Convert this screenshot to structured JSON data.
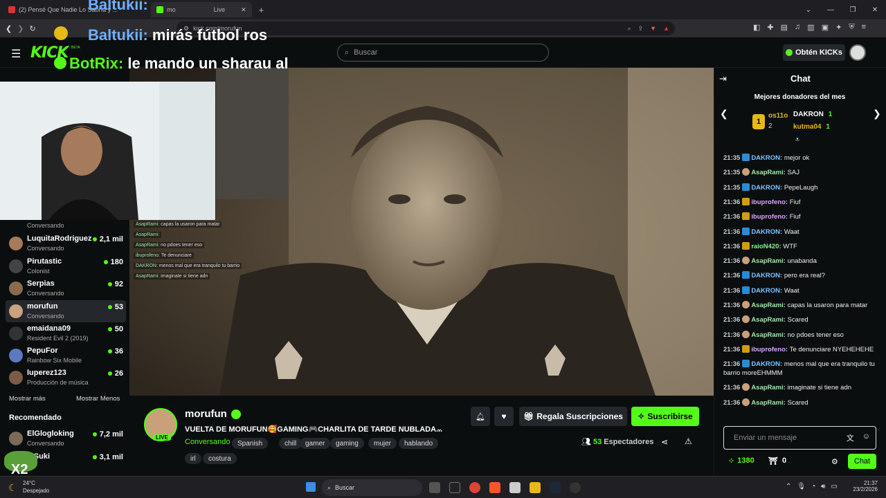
{
  "browser": {
    "tab_title": "(2) Pensé Que Nadie Lo Sabría y ...",
    "tab_title_2": "mo",
    "tab_title_3": "Live",
    "url": "kick.com/morufun"
  },
  "overlay_chat": [
    {
      "user": "Baltukii:",
      "text": "mirás fútbol ros"
    },
    {
      "user": "BotRix:",
      "text": "le mando un sharau al"
    }
  ],
  "header": {
    "logo": "KICK",
    "beta": "BETA",
    "search_placeholder": "Buscar",
    "get_kicks": "Obtén KICKs"
  },
  "sidebar": {
    "first_category": "Conversando",
    "channels": [
      {
        "name": "LuquitaRodriguez",
        "category": "Conversando",
        "viewers": "2,1 mil"
      },
      {
        "name": "Pirutastic",
        "category": "Colonist",
        "viewers": "180"
      },
      {
        "name": "Serpias",
        "category": "Conversando",
        "viewers": "92"
      },
      {
        "name": "morufun",
        "category": "Conversando",
        "viewers": "53"
      },
      {
        "name": "emaidana09",
        "category": "Resident Evil 2 (2019)",
        "viewers": "50"
      },
      {
        "name": "PepuFor",
        "category": "Rainbow Six Mobile",
        "viewers": "36"
      },
      {
        "name": "luperez123",
        "category": "Producción de música",
        "viewers": "26"
      }
    ],
    "show_more": "Mostrar más",
    "show_less": "Mostrar Menos",
    "recommended_title": "Recomendado",
    "recommended": [
      {
        "name": "ElGlogloking",
        "category": "Conversando",
        "viewers": "7,2 mil"
      },
      {
        "name": "etSuki",
        "category": "",
        "viewers": "3,1 mil"
      }
    ]
  },
  "video_overlay_chat": [
    {
      "user": "AsapRami",
      "text": ": capas la usaron para matar"
    },
    {
      "user": "AsapRami",
      "text": ":"
    },
    {
      "user": "AsapRami",
      "text": ": no pdoes tener eso"
    },
    {
      "user": "ibuprofeno",
      "text": ": Te denunciare"
    },
    {
      "user": "DAKRON",
      "text": ": menos mal que era tranquilo tu barrio"
    },
    {
      "user": "AsapRami",
      "text": ": imaginate si tiene adn"
    }
  ],
  "stream": {
    "channel": "morufun",
    "live_badge": "LIVE",
    "title": "VUELTA DE MORUFUN🥰GAMING🎮CHARLITA DE TARDE NUBLADA...",
    "category": "Conversando",
    "tags": [
      "Spanish",
      "chill",
      "gamer",
      "gaming",
      "mujer",
      "hablando",
      "irl",
      "costura"
    ],
    "gift_label": "Regala Suscripciones",
    "subscribe_label": "Suscribirse",
    "viewers": "53",
    "viewers_label": "Espectadores"
  },
  "chat": {
    "title": "Chat",
    "top_donors_title": "Mejores donadores del mes",
    "donors": [
      {
        "rank": "1",
        "name": "os11o",
        "amount": ""
      },
      {
        "rank": "2",
        "name": "",
        "amount": ""
      },
      {
        "name": "DAKRON",
        "amount": "1"
      },
      {
        "name": "kutma04",
        "amount": "1"
      }
    ],
    "messages": [
      {
        "time": "21:35",
        "user": "DAKRON",
        "color": "#7ec4ff",
        "badge": "blue",
        "text": "mejor ok"
      },
      {
        "time": "21:35",
        "user": "AsapRami",
        "color": "#9fe6a8",
        "badge": "avatar",
        "text": "SAJ"
      },
      {
        "time": "21:35",
        "user": "DAKRON",
        "color": "#7ec4ff",
        "badge": "blue",
        "text": "PepeLaugh"
      },
      {
        "time": "21:36",
        "user": "ibuprofeno",
        "color": "#d9a6ff",
        "badge": "gold",
        "text": "Fiuf"
      },
      {
        "time": "21:36",
        "user": "ibuprofeno",
        "color": "#d9a6ff",
        "badge": "gold",
        "text": "Fiuf"
      },
      {
        "time": "21:36",
        "user": "DAKRON",
        "color": "#7ec4ff",
        "badge": "blue",
        "text": "Waat"
      },
      {
        "time": "21:36",
        "user": "raioN420",
        "color": "#8ef08e",
        "badge": "gold",
        "text": "WTF"
      },
      {
        "time": "21:36",
        "user": "AsapRami",
        "color": "#9fe6a8",
        "badge": "avatar",
        "text": "unabanda"
      },
      {
        "time": "21:36",
        "user": "DAKRON",
        "color": "#7ec4ff",
        "badge": "blue",
        "text": "pero era real?"
      },
      {
        "time": "21:36",
        "user": "DAKRON",
        "color": "#7ec4ff",
        "badge": "blue",
        "text": "Waat"
      },
      {
        "time": "21:36",
        "user": "AsapRami",
        "color": "#9fe6a8",
        "badge": "avatar",
        "text": "capas la usaron para matar"
      },
      {
        "time": "21:36",
        "user": "AsapRami",
        "color": "#9fe6a8",
        "badge": "avatar",
        "text": "Scared"
      },
      {
        "time": "21:36",
        "user": "AsapRami",
        "color": "#9fe6a8",
        "badge": "avatar",
        "text": "no pdoes tener eso"
      },
      {
        "time": "21:36",
        "user": "ibuprofeno",
        "color": "#d9a6ff",
        "badge": "gold",
        "text": "Te denunciare NYEHEHEHE"
      },
      {
        "time": "21:36",
        "user": "DAKRON",
        "color": "#7ec4ff",
        "badge": "blue",
        "text": "menos mal que era tranquilo tu barrio moreEHMMM"
      },
      {
        "time": "21:36",
        "user": "AsapRami",
        "color": "#9fe6a8",
        "badge": "avatar",
        "text": "imaginate si tiene adn"
      },
      {
        "time": "21:36",
        "user": "AsapRami",
        "color": "#9fe6a8",
        "badge": "avatar",
        "text": "Scared"
      }
    ],
    "input_placeholder": "Enviar un mensaje",
    "points": "1380",
    "gifts": "0",
    "send_label": "Chat"
  },
  "taskbar": {
    "weather_temp": "24°C",
    "weather_desc": "Despejado",
    "search": "Buscar",
    "time": "21:37",
    "date": "23/2/2026"
  },
  "overlay_x2": "X2"
}
